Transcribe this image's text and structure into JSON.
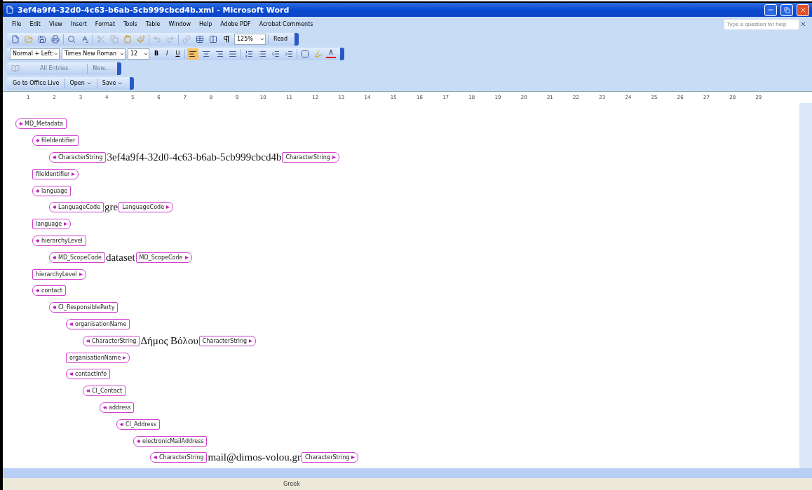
{
  "window": {
    "title": "3ef4a9f4-32d0-4c63-b6ab-5cb999cbcd4b.xml - Microsoft Word"
  },
  "menu": [
    "File",
    "Edit",
    "View",
    "Insert",
    "Format",
    "Tools",
    "Table",
    "Window",
    "Help",
    "Adobe PDF",
    "Acrobat Comments"
  ],
  "help_box": {
    "placeholder": "Type a question for help"
  },
  "standard_toolbar": {
    "zoom": "125%",
    "read": "Read"
  },
  "formatting_toolbar": {
    "style": "Normal + Left:",
    "font": "Times New Roman",
    "size": "12",
    "bold": "B",
    "italic": "I",
    "underline": "U",
    "align_left_selected": true,
    "font_color": "A"
  },
  "autotext_toolbar": {
    "entries": "All Entries",
    "new": "New...",
    "disabled": true
  },
  "office_live_toolbar": {
    "go": "Go to Office Live",
    "open": "Open",
    "save": "Save"
  },
  "ruler": [
    "1",
    "2",
    "3",
    "4",
    "5",
    "6",
    "7",
    "8",
    "9",
    "10",
    "11",
    "12",
    "13",
    "14",
    "15",
    "16",
    "17",
    "18",
    "19",
    "20",
    "21",
    "22",
    "23",
    "24",
    "25",
    "26",
    "27",
    "28",
    "29"
  ],
  "document": {
    "nodes": [
      {
        "tag": "MD_Metadata",
        "children": [
          {
            "tag": "fileIdentifier",
            "end_tag": "fileIdentifier",
            "children": [
              {
                "tag": "CharacterString",
                "value": "3ef4a9f4-32d0-4c63-b6ab-5cb999cbcd4b",
                "end_tag": "CharacterString"
              }
            ]
          },
          {
            "tag": "language",
            "end_tag": "language",
            "children": [
              {
                "tag": "LanguageCode",
                "value": "gre",
                "end_tag": "LanguageCode"
              }
            ]
          },
          {
            "tag": "hierarchyLevel",
            "end_tag": "hierarchyLevel",
            "children": [
              {
                "tag": "MD_ScopeCode",
                "value": "dataset",
                "end_tag": "MD_ScopeCode"
              }
            ]
          },
          {
            "tag": "contact",
            "children": [
              {
                "tag": "CI_ResponsibleParty",
                "children": [
                  {
                    "tag": "organisationName",
                    "end_tag": "organisationName",
                    "children": [
                      {
                        "tag": "CharacterString",
                        "value": "Δήμος Βόλου",
                        "end_tag": "CharacterString"
                      }
                    ]
                  },
                  {
                    "tag": "contactInfo",
                    "children": [
                      {
                        "tag": "CI_Contact",
                        "children": [
                          {
                            "tag": "address",
                            "children": [
                              {
                                "tag": "CI_Address",
                                "children": [
                                  {
                                    "tag": "electronicMailAddress",
                                    "children": [
                                      {
                                        "tag": "CharacterString",
                                        "value": "mail@dimos-volou.gr",
                                        "end_tag": "CharacterString"
                                      }
                                    ]
                                  }
                                ]
                              }
                            ]
                          }
                        ]
                      }
                    ]
                  }
                ]
              }
            ]
          }
        ]
      }
    ]
  },
  "status_bar": {
    "language": "Greek"
  }
}
